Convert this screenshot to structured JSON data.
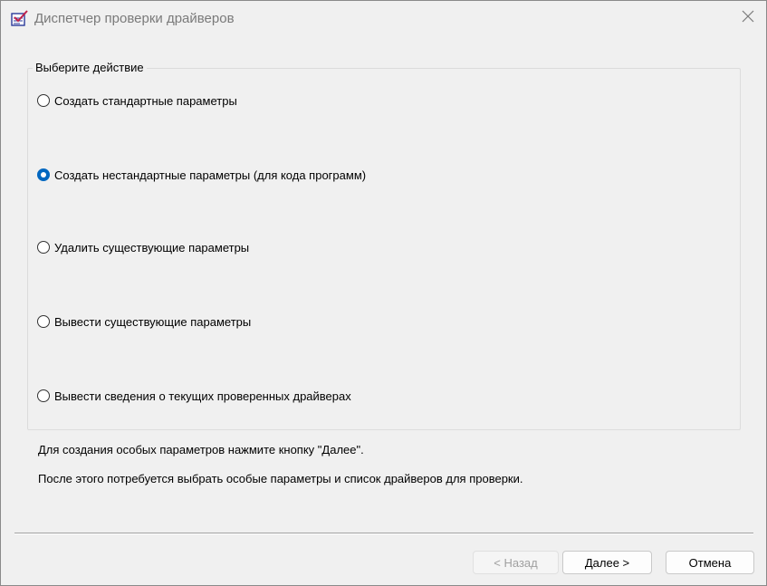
{
  "window": {
    "title": "Диспетчер проверки драйверов",
    "app_icon": "checklist-app-icon",
    "close_icon": "close-icon"
  },
  "group": {
    "label": "Выберите действие",
    "options": [
      {
        "label": "Создать стандартные параметры",
        "checked": false
      },
      {
        "label": "Создать нестандартные параметры (для кода программ)",
        "checked": true
      },
      {
        "label": "Удалить существующие параметры",
        "checked": false
      },
      {
        "label": "Вывести существующие параметры",
        "checked": false
      },
      {
        "label": "Вывести сведения о текущих проверенных драйверах",
        "checked": false
      }
    ]
  },
  "info": {
    "line1": "Для создания особых параметров нажмите кнопку \"Далее\".",
    "line2": "После этого потребуется выбрать особые параметры и список драйверов для проверки."
  },
  "buttons": {
    "back": "< Назад",
    "back_enabled": false,
    "next": "Далее >",
    "cancel": "Отмена"
  },
  "colors": {
    "accent": "#0067c0",
    "title_text": "#7a7a7a",
    "disabled_text": "#a0a0a0"
  }
}
